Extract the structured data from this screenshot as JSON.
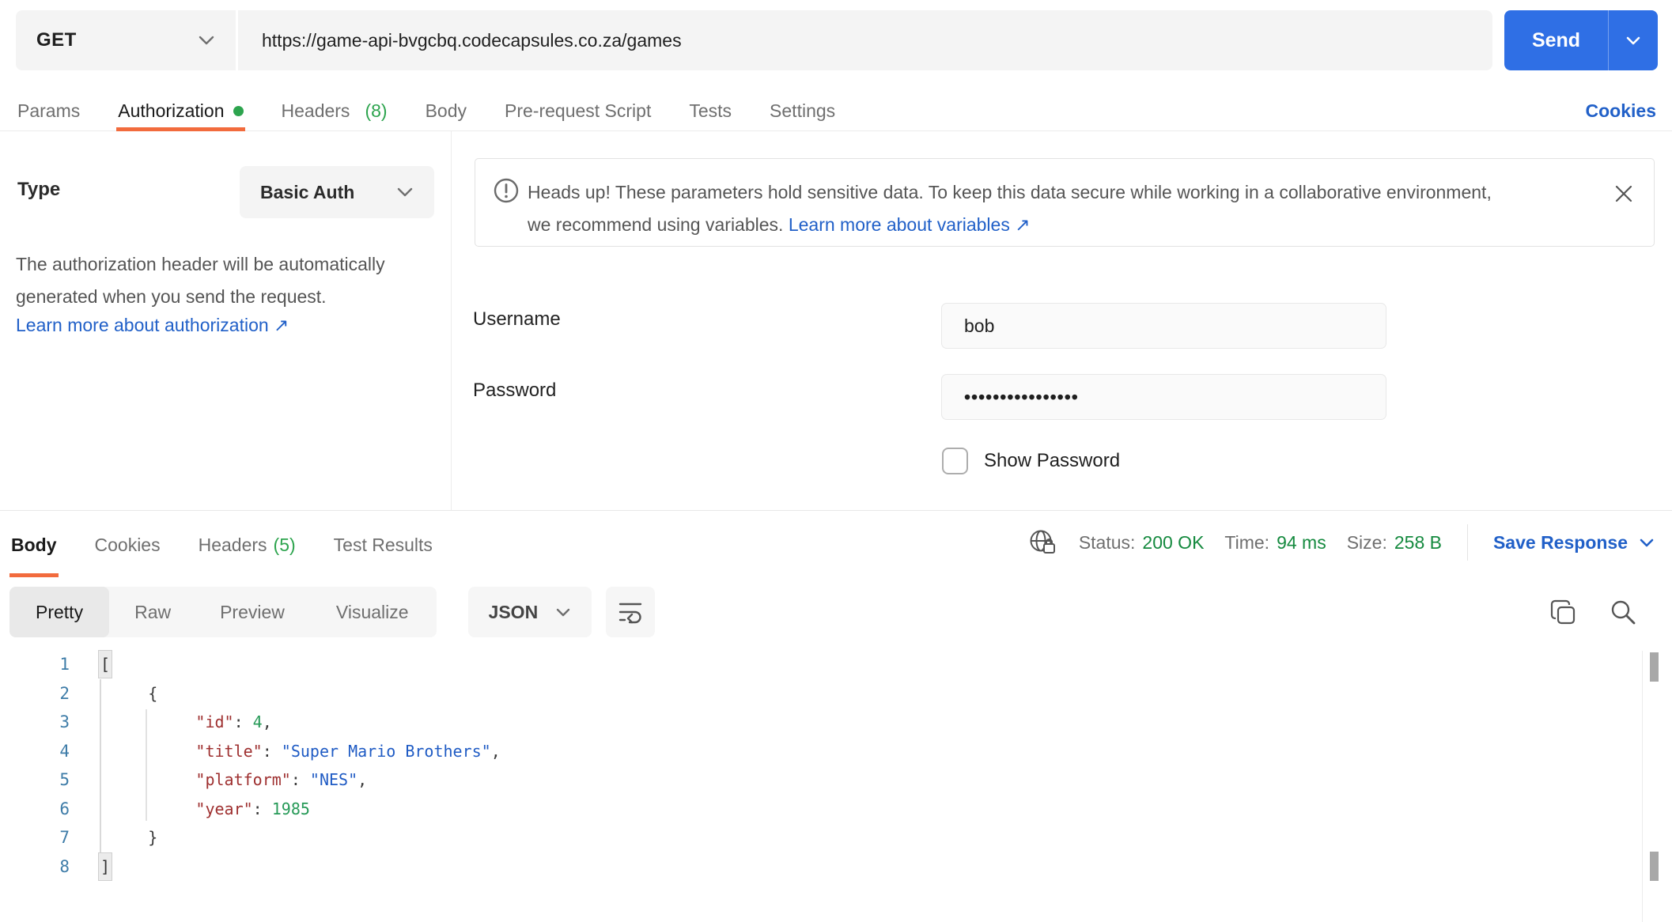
{
  "request_bar": {
    "method": "GET",
    "url": "https://game-api-bvgcbq.codecapsules.co.za/games",
    "send_label": "Send"
  },
  "request_tabs": {
    "params": "Params",
    "authorization": "Authorization",
    "headers": "Headers",
    "headers_count": "(8)",
    "body": "Body",
    "prerequest": "Pre-request Script",
    "tests": "Tests",
    "settings": "Settings",
    "cookies_link": "Cookies"
  },
  "auth": {
    "type_label": "Type",
    "type_value": "Basic Auth",
    "description": "The authorization header will be automatically generated when you send the request.",
    "learn_link": "Learn more about authorization",
    "external_arrow": "↗",
    "warning_line1": "Heads up! These parameters hold sensitive data. To keep this data secure while working in a collaborative environment,",
    "warning_line2": "we recommend using variables. ",
    "warning_link": "Learn more about variables",
    "username_label": "Username",
    "username_value": "bob",
    "password_label": "Password",
    "password_value": "••••••••••••••••",
    "show_password_label": "Show Password"
  },
  "response": {
    "tabs": {
      "body": "Body",
      "cookies": "Cookies",
      "headers": "Headers",
      "headers_count": "(5)",
      "test_results": "Test Results"
    },
    "status_label": "Status:",
    "status_value": "200 OK",
    "time_label": "Time:",
    "time_value": "94 ms",
    "size_label": "Size:",
    "size_value": "258 B",
    "save_response_label": "Save Response",
    "view_modes": {
      "pretty": "Pretty",
      "raw": "Raw",
      "preview": "Preview",
      "visualize": "Visualize"
    },
    "format_value": "JSON",
    "code": {
      "lines": [
        {
          "num": "1",
          "tokens": [
            {
              "t": "hl",
              "v": "["
            }
          ]
        },
        {
          "num": "2",
          "tokens": [
            {
              "t": "pun",
              "v": "     {"
            }
          ]
        },
        {
          "num": "3",
          "tokens": [
            {
              "t": "key",
              "v": "          \"id\""
            },
            {
              "t": "pun",
              "v": ": "
            },
            {
              "t": "num",
              "v": "4"
            },
            {
              "t": "pun",
              "v": ","
            }
          ]
        },
        {
          "num": "4",
          "tokens": [
            {
              "t": "key",
              "v": "          \"title\""
            },
            {
              "t": "pun",
              "v": ": "
            },
            {
              "t": "str",
              "v": "\"Super Mario Brothers\""
            },
            {
              "t": "pun",
              "v": ","
            }
          ]
        },
        {
          "num": "5",
          "tokens": [
            {
              "t": "key",
              "v": "          \"platform\""
            },
            {
              "t": "pun",
              "v": ": "
            },
            {
              "t": "str",
              "v": "\"NES\""
            },
            {
              "t": "pun",
              "v": ","
            }
          ]
        },
        {
          "num": "6",
          "tokens": [
            {
              "t": "key",
              "v": "          \"year\""
            },
            {
              "t": "pun",
              "v": ": "
            },
            {
              "t": "num",
              "v": "1985"
            }
          ]
        },
        {
          "num": "7",
          "tokens": [
            {
              "t": "pun",
              "v": "     }"
            }
          ]
        },
        {
          "num": "8",
          "tokens": [
            {
              "t": "hl",
              "v": "]"
            }
          ]
        }
      ]
    }
  },
  "icons": {
    "method_caret": "chevron-down",
    "send_caret": "chevron-down",
    "warning": "exclamation-circle",
    "close": "x",
    "network": "globe-lock",
    "wrap": "text-wrap",
    "copy": "copy",
    "search": "magnifier"
  },
  "accent_colors": {
    "send_blue": "#2f6fe5",
    "link_blue": "#2160c8",
    "tab_orange": "#f26b3d",
    "green_badge": "#2da44e",
    "status_green": "#158a3f",
    "code_key_red": "#9e2f2f",
    "code_string_blue": "#1f5bc4",
    "code_number_green": "#279a58",
    "line_number_blue": "#3e7ca8"
  }
}
